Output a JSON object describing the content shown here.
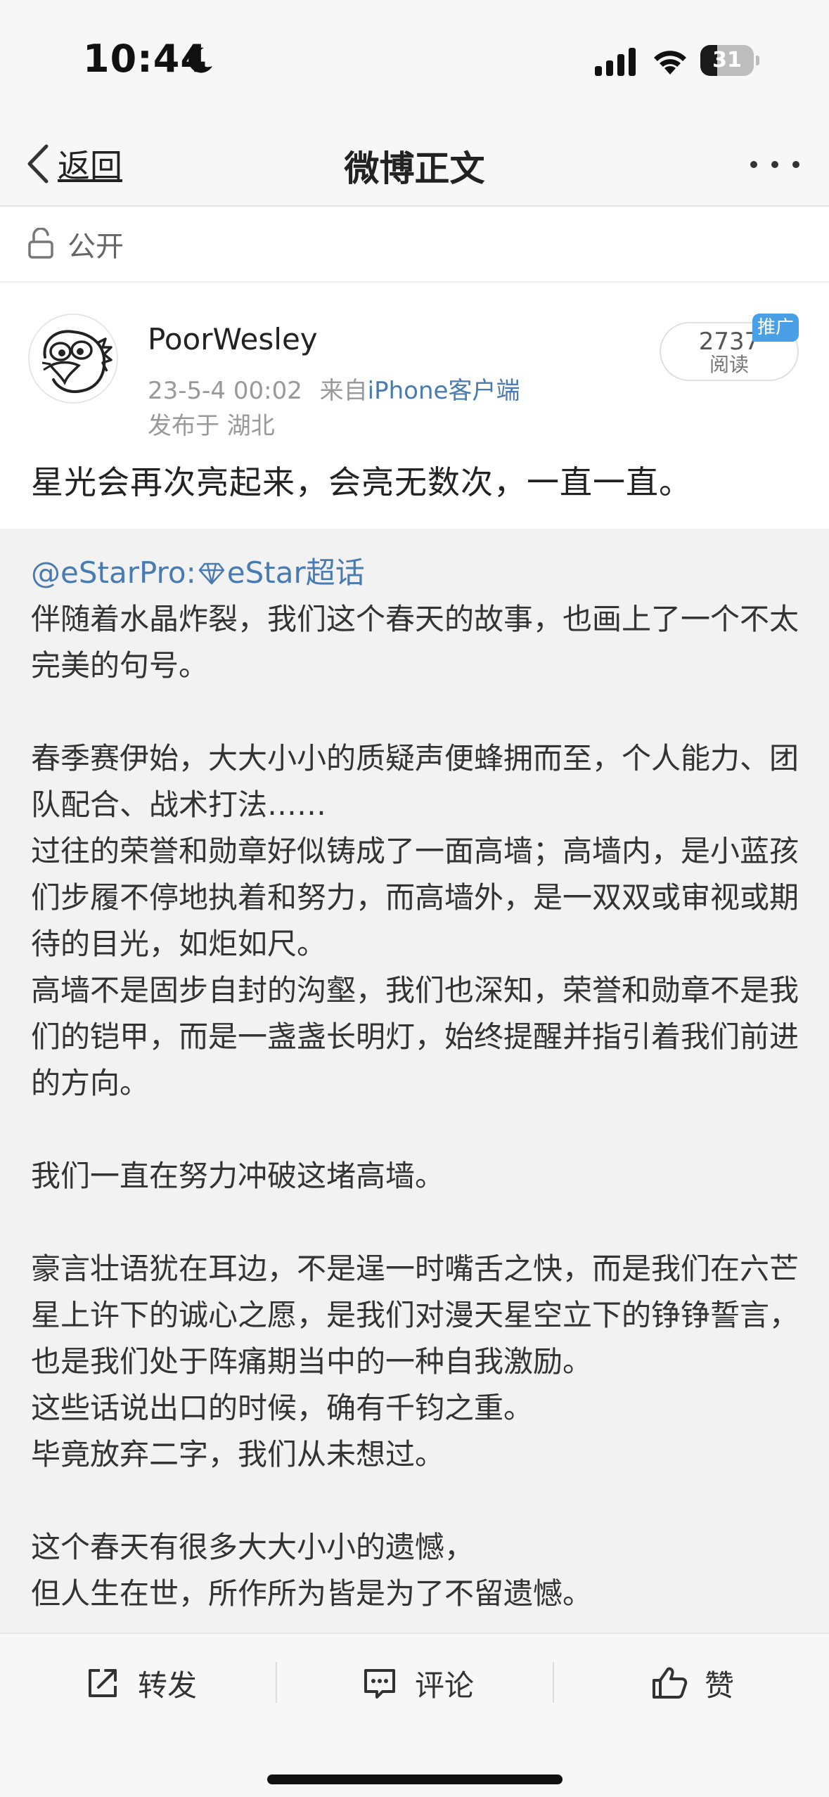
{
  "status_bar": {
    "time": "10:44",
    "battery": "31",
    "battery_level": 0.31
  },
  "nav": {
    "back_label": "返回",
    "title": "微博正文"
  },
  "visibility": {
    "label": "公开"
  },
  "post": {
    "username": "PoorWesley",
    "timestamp": "23-5-4 00:02",
    "source_prefix": "来自",
    "source": "iPhone客户端",
    "location": "发布于 湖北",
    "read_count": "2737",
    "read_label": "阅读",
    "promo_tag": "推广",
    "text": "星光会再次亮起来，会亮无数次，一直一直。"
  },
  "repost": {
    "author": "@eStarPro",
    "colon": ":",
    "topic": "eStar超话",
    "paragraphs": [
      "伴随着水晶炸裂，我们这个春天的故事，也画上了一个不太完美的句号。",
      "",
      "春季赛伊始，大大小小的质疑声便蜂拥而至，个人能力、团队配合、战术打法……",
      "过往的荣誉和勋章好似铸成了一面高墙；高墙内，是小蓝孩们步履不停地执着和努力，而高墙外，是一双双或审视或期待的目光，如炬如尺。",
      "高墙不是固步自封的沟壑，我们也深知，荣誉和勋章不是我们的铠甲，而是一盏盏长明灯，始终提醒并指引着我们前进的方向。",
      "",
      "我们一直在努力冲破这堵高墙。",
      "",
      "豪言壮语犹在耳边，不是逞一时嘴舌之快，而是我们在六芒星上许下的诚心之愿，是我们对漫天星空立下的铮铮誓言，也是我们处于阵痛期当中的一种自我激励。",
      "这些话说出口的时候，确有千钧之重。",
      "毕竟放弃二字，我们从未想过。",
      "",
      "这个春天有很多大大小小的遗憾，",
      "但人生在世，所作所为皆是为了不留遗憾。"
    ]
  },
  "actions": {
    "forward": "转发",
    "comment": "评论",
    "like": "赞"
  },
  "colors": {
    "link": "#4a7bb0",
    "promo": "#4aa0e6",
    "repost_bg": "#f2f2f2"
  }
}
